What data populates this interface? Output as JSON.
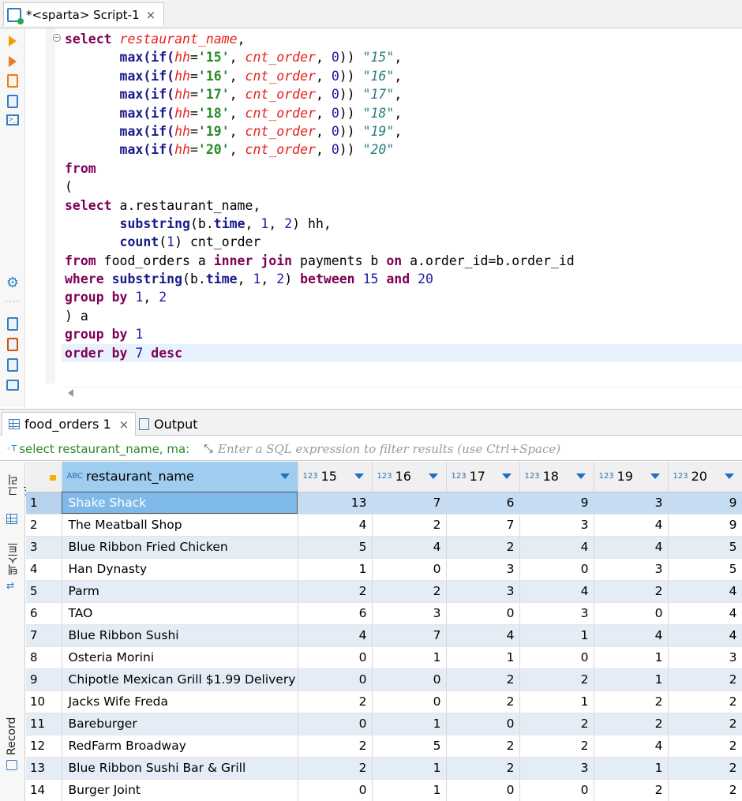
{
  "editor_tab": {
    "title": "*<sparta> Script-1",
    "close": "×"
  },
  "code_lines": [
    [
      [
        "kw",
        "select "
      ],
      [
        "col",
        "restaurant_name"
      ],
      [
        "txt",
        ","
      ]
    ],
    [
      [
        "txt",
        "       "
      ],
      [
        "fn",
        "max(if("
      ],
      [
        "col",
        "hh"
      ],
      [
        "txt",
        "="
      ],
      [
        "str",
        "'15'"
      ],
      [
        "txt",
        ", "
      ],
      [
        "col",
        "cnt_order"
      ],
      [
        "txt",
        ", "
      ],
      [
        "num",
        "0"
      ],
      [
        "txt",
        "))"
      ],
      [
        "txt",
        " "
      ],
      [
        "alias",
        "\"15\""
      ],
      [
        "txt",
        ","
      ]
    ],
    [
      [
        "txt",
        "       "
      ],
      [
        "fn",
        "max(if("
      ],
      [
        "col",
        "hh"
      ],
      [
        "txt",
        "="
      ],
      [
        "str",
        "'16'"
      ],
      [
        "txt",
        ", "
      ],
      [
        "col",
        "cnt_order"
      ],
      [
        "txt",
        ", "
      ],
      [
        "num",
        "0"
      ],
      [
        "txt",
        "))"
      ],
      [
        "txt",
        " "
      ],
      [
        "alias",
        "\"16\""
      ],
      [
        "txt",
        ","
      ]
    ],
    [
      [
        "txt",
        "       "
      ],
      [
        "fn",
        "max(if("
      ],
      [
        "col",
        "hh"
      ],
      [
        "txt",
        "="
      ],
      [
        "str",
        "'17'"
      ],
      [
        "txt",
        ", "
      ],
      [
        "col",
        "cnt_order"
      ],
      [
        "txt",
        ", "
      ],
      [
        "num",
        "0"
      ],
      [
        "txt",
        "))"
      ],
      [
        "txt",
        " "
      ],
      [
        "alias",
        "\"17\""
      ],
      [
        "txt",
        ","
      ]
    ],
    [
      [
        "txt",
        "       "
      ],
      [
        "fn",
        "max(if("
      ],
      [
        "col",
        "hh"
      ],
      [
        "txt",
        "="
      ],
      [
        "str",
        "'18'"
      ],
      [
        "txt",
        ", "
      ],
      [
        "col",
        "cnt_order"
      ],
      [
        "txt",
        ", "
      ],
      [
        "num",
        "0"
      ],
      [
        "txt",
        "))"
      ],
      [
        "txt",
        " "
      ],
      [
        "alias",
        "\"18\""
      ],
      [
        "txt",
        ","
      ]
    ],
    [
      [
        "txt",
        "       "
      ],
      [
        "fn",
        "max(if("
      ],
      [
        "col",
        "hh"
      ],
      [
        "txt",
        "="
      ],
      [
        "str",
        "'19'"
      ],
      [
        "txt",
        ", "
      ],
      [
        "col",
        "cnt_order"
      ],
      [
        "txt",
        ", "
      ],
      [
        "num",
        "0"
      ],
      [
        "txt",
        "))"
      ],
      [
        "txt",
        " "
      ],
      [
        "alias",
        "\"19\""
      ],
      [
        "txt",
        ","
      ]
    ],
    [
      [
        "txt",
        "       "
      ],
      [
        "fn",
        "max(if("
      ],
      [
        "col",
        "hh"
      ],
      [
        "txt",
        "="
      ],
      [
        "str",
        "'20'"
      ],
      [
        "txt",
        ", "
      ],
      [
        "col",
        "cnt_order"
      ],
      [
        "txt",
        ", "
      ],
      [
        "num",
        "0"
      ],
      [
        "txt",
        "))"
      ],
      [
        "txt",
        " "
      ],
      [
        "alias",
        "\"20\""
      ]
    ],
    [
      [
        "kw",
        "from"
      ]
    ],
    [
      [
        "txt",
        "("
      ]
    ],
    [
      [
        "kw",
        "select "
      ],
      [
        "txt",
        "a.restaurant_name,"
      ]
    ],
    [
      [
        "txt",
        "       "
      ],
      [
        "fn",
        "substring"
      ],
      [
        "txt",
        "(b."
      ],
      [
        "fn",
        "time"
      ],
      [
        "txt",
        ", "
      ],
      [
        "num",
        "1"
      ],
      [
        "txt",
        ", "
      ],
      [
        "num",
        "2"
      ],
      [
        "txt",
        ") hh,"
      ]
    ],
    [
      [
        "txt",
        "       "
      ],
      [
        "fn",
        "count"
      ],
      [
        "txt",
        "("
      ],
      [
        "num",
        "1"
      ],
      [
        "txt",
        ") cnt_order"
      ]
    ],
    [
      [
        "kw",
        "from "
      ],
      [
        "txt",
        "food_orders a "
      ],
      [
        "kw",
        "inner join "
      ],
      [
        "txt",
        "payments b "
      ],
      [
        "kw",
        "on "
      ],
      [
        "txt",
        "a.order_id=b.order_id"
      ]
    ],
    [
      [
        "kw",
        "where "
      ],
      [
        "fn",
        "substring"
      ],
      [
        "txt",
        "(b."
      ],
      [
        "fn",
        "time"
      ],
      [
        "txt",
        ", "
      ],
      [
        "num",
        "1"
      ],
      [
        "txt",
        ", "
      ],
      [
        "num",
        "2"
      ],
      [
        "txt",
        ") "
      ],
      [
        "kw",
        "between "
      ],
      [
        "num",
        "15"
      ],
      [
        "txt",
        " "
      ],
      [
        "kw",
        "and "
      ],
      [
        "num",
        "20"
      ]
    ],
    [
      [
        "kw",
        "group by "
      ],
      [
        "num",
        "1"
      ],
      [
        "txt",
        ", "
      ],
      [
        "num",
        "2"
      ]
    ],
    [
      [
        "txt",
        ") a"
      ]
    ],
    [
      [
        "kw",
        "group by "
      ],
      [
        "num",
        "1"
      ]
    ],
    [
      [
        "kw",
        "order by "
      ],
      [
        "num",
        "7"
      ],
      [
        "txt",
        " "
      ],
      [
        "kw",
        "desc"
      ]
    ]
  ],
  "results_tabs": {
    "food_orders": "food_orders 1",
    "close": "×",
    "output": "Output"
  },
  "filter": {
    "query": "select restaurant_name, ma:",
    "placeholder": "Enter a SQL expression to filter results (use Ctrl+Space)"
  },
  "side_labels": {
    "grid": "그리드",
    "text": "텍스트",
    "record": "Record"
  },
  "grid": {
    "type_tags": {
      "text": "ABC",
      "number": "123"
    },
    "columns": [
      "restaurant_name",
      "15",
      "16",
      "17",
      "18",
      "19",
      "20"
    ],
    "rows": [
      [
        "1",
        "Shake Shack",
        "13",
        "7",
        "6",
        "9",
        "3",
        "9"
      ],
      [
        "2",
        "The Meatball Shop",
        "4",
        "2",
        "7",
        "3",
        "4",
        "9"
      ],
      [
        "3",
        "Blue Ribbon Fried Chicken",
        "5",
        "4",
        "2",
        "4",
        "4",
        "5"
      ],
      [
        "4",
        "Han Dynasty",
        "1",
        "0",
        "3",
        "0",
        "3",
        "5"
      ],
      [
        "5",
        "Parm",
        "2",
        "2",
        "3",
        "4",
        "2",
        "4"
      ],
      [
        "6",
        "TAO",
        "6",
        "3",
        "0",
        "3",
        "0",
        "4"
      ],
      [
        "7",
        "Blue Ribbon Sushi",
        "4",
        "7",
        "4",
        "1",
        "4",
        "4"
      ],
      [
        "8",
        "Osteria Morini",
        "0",
        "1",
        "1",
        "0",
        "1",
        "3"
      ],
      [
        "9",
        "Chipotle Mexican Grill $1.99 Delivery",
        "0",
        "0",
        "2",
        "2",
        "1",
        "2"
      ],
      [
        "10",
        "Jacks Wife Freda",
        "2",
        "0",
        "2",
        "1",
        "2",
        "2"
      ],
      [
        "11",
        "Bareburger",
        "0",
        "1",
        "0",
        "2",
        "2",
        "2"
      ],
      [
        "12",
        "RedFarm Broadway",
        "2",
        "5",
        "2",
        "2",
        "4",
        "2"
      ],
      [
        "13",
        "Blue Ribbon Sushi Bar & Grill",
        "2",
        "1",
        "2",
        "3",
        "1",
        "2"
      ],
      [
        "14",
        "Burger Joint",
        "0",
        "1",
        "0",
        "0",
        "2",
        "2"
      ]
    ]
  }
}
